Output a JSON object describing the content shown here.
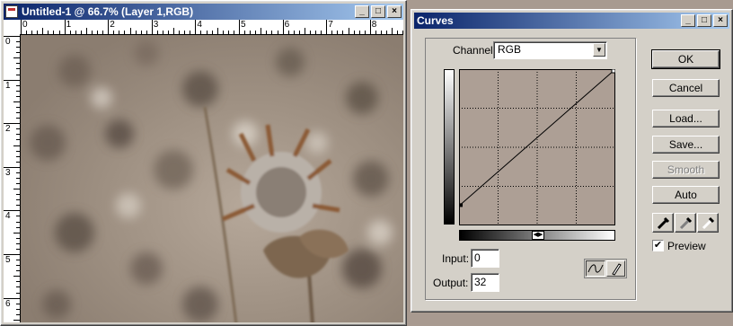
{
  "image_window": {
    "title": "Untitled-1 @ 66.7% (Layer 1,RGB)",
    "ruler_h_labels": [
      "0",
      "1",
      "2",
      "3",
      "4",
      "5",
      "6",
      "7",
      "8"
    ],
    "ruler_v_labels": [
      "0",
      "1",
      "2",
      "3",
      "4",
      "5",
      "6"
    ],
    "controls": {
      "minimize": "_",
      "maximize": "□",
      "close": "×"
    }
  },
  "curves_dialog": {
    "title": "Curves",
    "channel_label": "Channel:",
    "channel_value": "RGB",
    "input_label": "Input:",
    "input_value": "0",
    "output_label": "Output:",
    "output_value": "32",
    "buttons": {
      "ok": "OK",
      "cancel": "Cancel",
      "load": "Load...",
      "save": "Save...",
      "smooth": "Smooth",
      "auto": "Auto"
    },
    "preview_label": "Preview",
    "preview_checked": true,
    "curve_points": [
      [
        0,
        32
      ],
      [
        255,
        255
      ]
    ],
    "controls": {
      "minimize": "_",
      "maximize": "□",
      "close": "×"
    }
  }
}
